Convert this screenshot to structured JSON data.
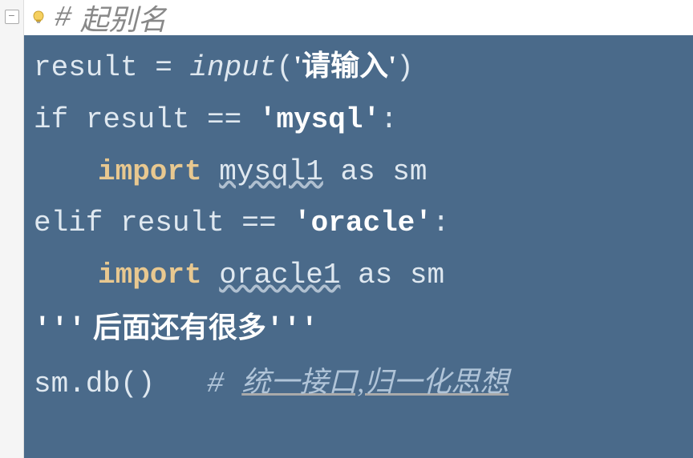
{
  "gutter": {
    "fold_marker": "−"
  },
  "header": {
    "hash": "#",
    "comment": "起别名"
  },
  "code": {
    "line1": {
      "lhs": "result = ",
      "builtin": "input",
      "paren_open": "(",
      "string": "'请输入'",
      "paren_close": ")"
    },
    "line2": {
      "kw": "if",
      "cond": " result == ",
      "string": "'mysql'",
      "colon": ":"
    },
    "line3": {
      "kw": "import",
      "space": " ",
      "mod": "mysql1",
      "rest": " as sm"
    },
    "line4": {
      "kw": "elif",
      "cond": " result == ",
      "string": "'oracle'",
      "colon": ":"
    },
    "line5": {
      "kw": "import",
      "space": " ",
      "mod": "oracle1",
      "rest": " as sm"
    },
    "line6": {
      "triple_open": "'''",
      "text": " 后面还有很多",
      "triple_close": "'''"
    },
    "line7": {
      "call": "sm.db() ",
      "hash": "  # ",
      "comment": "统一接口,归一化思想"
    }
  }
}
